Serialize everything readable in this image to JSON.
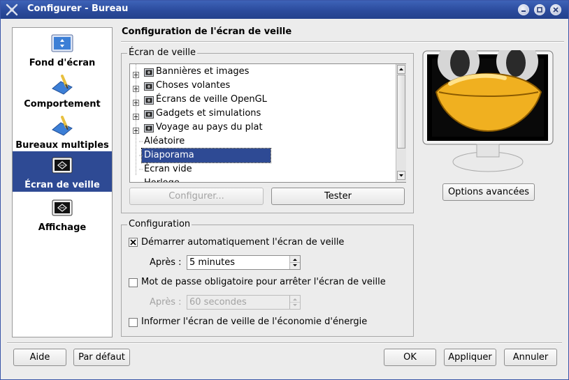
{
  "window": {
    "title": "Configurer - Bureau",
    "app_icon": "kde-config-icon"
  },
  "sidebar": {
    "items": [
      {
        "label": "Fond d'écran",
        "icon": "wallpaper-icon"
      },
      {
        "label": "Comportement",
        "icon": "behavior-icon"
      },
      {
        "label": "Bureaux multiples",
        "icon": "desktops-icon"
      },
      {
        "label": "Écran de veille",
        "icon": "screensaver-icon",
        "active": true
      },
      {
        "label": "Affichage",
        "icon": "display-icon"
      }
    ]
  },
  "main": {
    "title": "Configuration de l'écran de veille",
    "saver_group": {
      "legend": "Écran de veille",
      "tree": [
        {
          "label": "Bannières et images",
          "type": "folder"
        },
        {
          "label": "Choses volantes",
          "type": "folder"
        },
        {
          "label": "Écrans de veille OpenGL",
          "type": "folder"
        },
        {
          "label": "Gadgets et simulations",
          "type": "folder"
        },
        {
          "label": "Voyage au pays du plat",
          "type": "folder"
        },
        {
          "label": "Aléatoire",
          "type": "leaf"
        },
        {
          "label": "Diaporama",
          "type": "leaf",
          "selected": true
        },
        {
          "label": "Écran vide",
          "type": "leaf"
        },
        {
          "label": "Horloge",
          "type": "leaf"
        }
      ],
      "configure_btn": "Configurer...",
      "test_btn": "Tester"
    },
    "advanced_btn": "Options avancées",
    "config_group": {
      "legend": "Configuration",
      "auto_start": {
        "label": "Démarrer automatiquement l'écran de veille",
        "checked": true
      },
      "after1": {
        "label": "Après :",
        "value": "5 minutes"
      },
      "password": {
        "label": "Mot de passe obligatoire pour arrêter l'écran de veille",
        "checked": false
      },
      "after2": {
        "label": "Après :",
        "value": "60 secondes"
      },
      "energy": {
        "label": "Informer l'écran de veille de l'économie d'énergie",
        "checked": false
      }
    }
  },
  "footer": {
    "help": "Aide",
    "defaults": "Par défaut",
    "ok": "OK",
    "apply": "Appliquer",
    "cancel": "Annuler"
  },
  "colors": {
    "accent": "#2e4a94",
    "titlebar": "#2b4b9c",
    "window_bg": "#ececec"
  }
}
